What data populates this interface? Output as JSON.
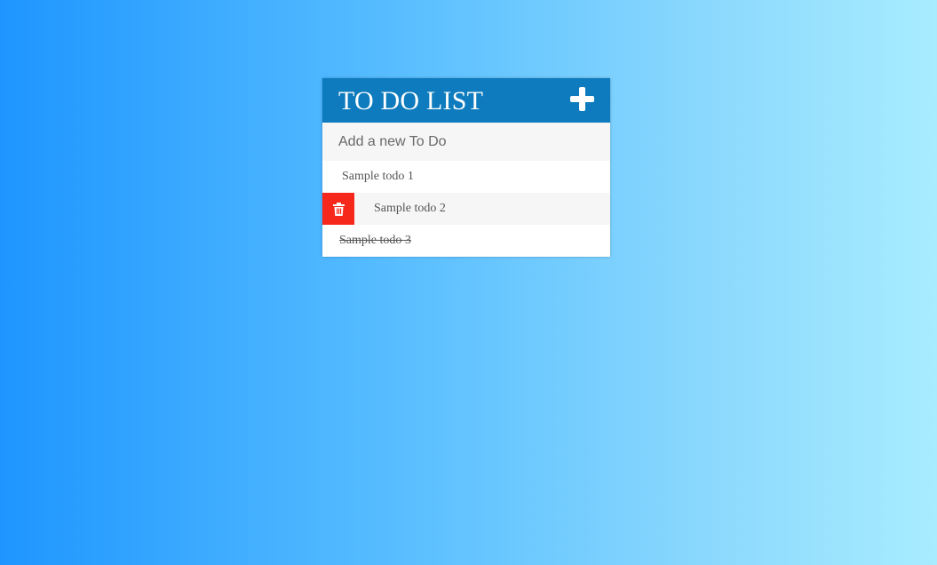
{
  "header": {
    "title": "TO DO LIST",
    "add_icon": "plus-icon",
    "color": "#0d7bbd"
  },
  "new_todo": {
    "placeholder": "Add a new To Do",
    "value": ""
  },
  "todos": [
    {
      "text": "Sample todo 1",
      "completed": false
    },
    {
      "text": "Sample todo 2",
      "completed": false,
      "delete_visible": true,
      "delete_icon": "trash-icon"
    },
    {
      "text": "Sample todo 3",
      "completed": true
    }
  ],
  "colors": {
    "delete": "#f5281b",
    "background_start": "#1e96ff",
    "background_end": "#a8ecff"
  }
}
